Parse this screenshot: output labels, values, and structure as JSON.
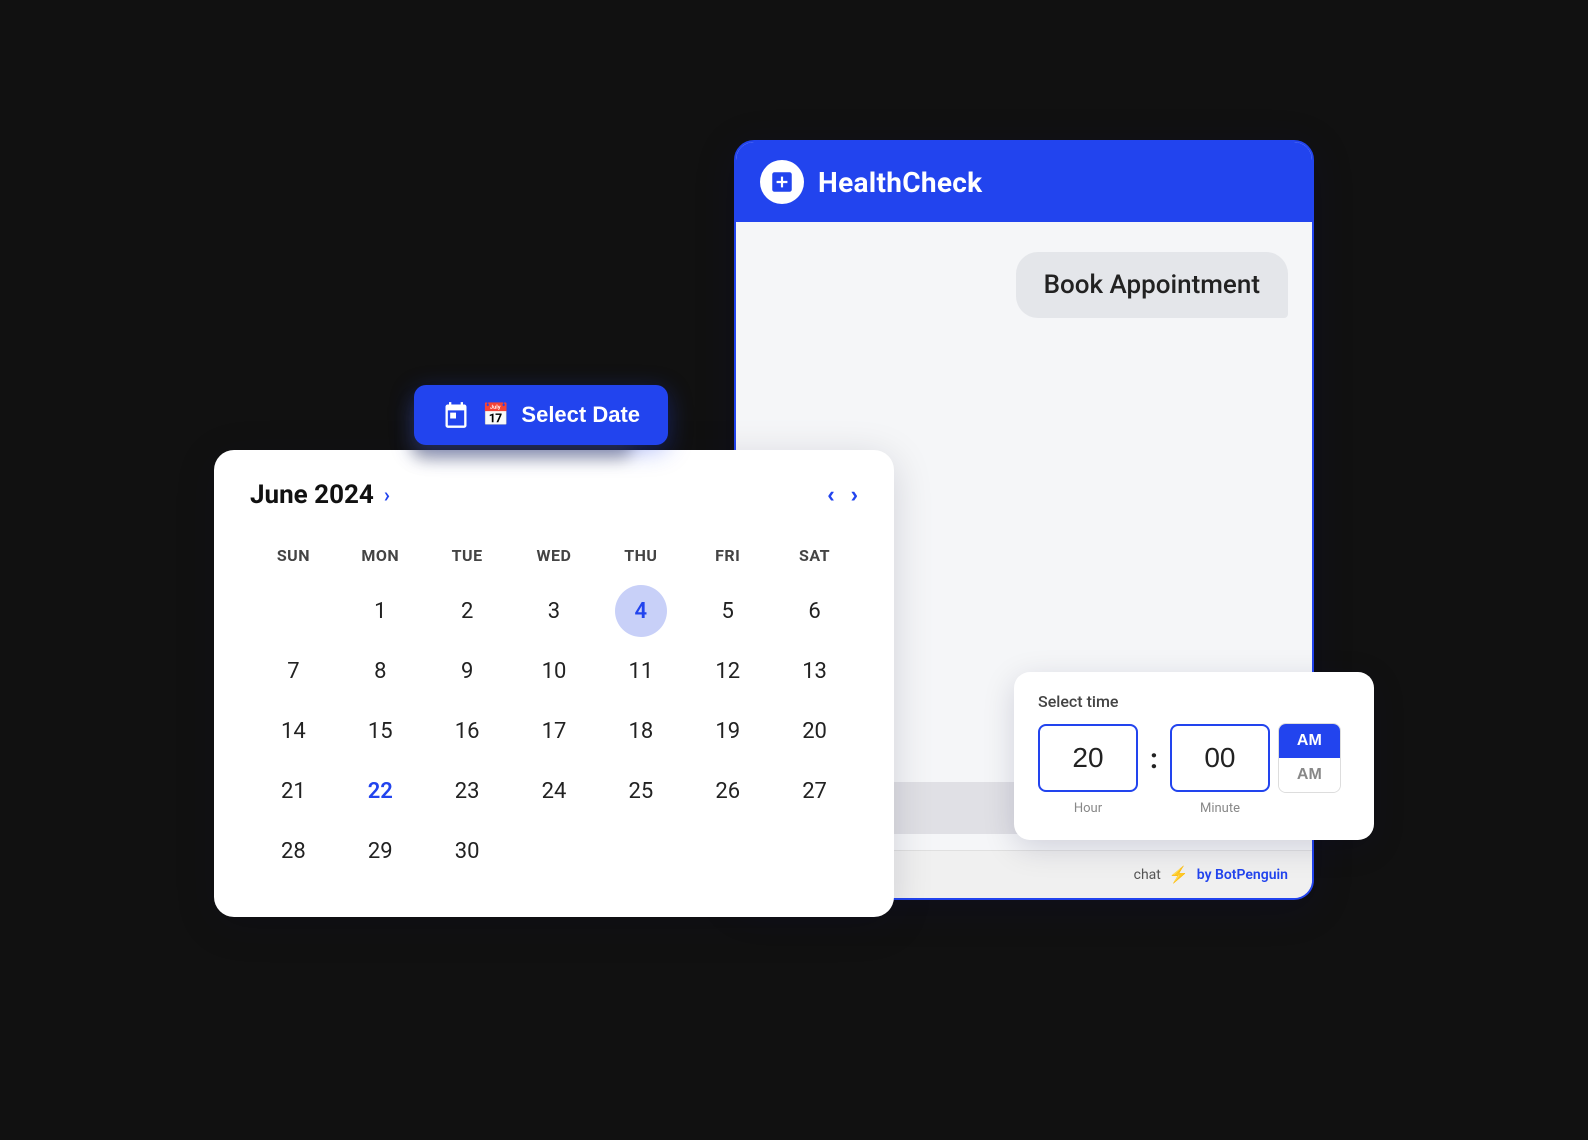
{
  "app": {
    "name": "HealthCheck",
    "header_bg": "#2244ee"
  },
  "chat": {
    "bot_bubble": "Book Appointment",
    "select_date_label": "Select Date",
    "footer_chat_label": "hat",
    "footer_lightning": "⚡",
    "footer_by": "by BotPenguin"
  },
  "calendar": {
    "month_label": "June 2024",
    "chevron_label": ">",
    "days_headers": [
      "SUN",
      "MON",
      "TUE",
      "WED",
      "THU",
      "FRI",
      "SAT"
    ],
    "selected_day": 4,
    "today_day": 22,
    "weeks": [
      [
        null,
        1,
        2,
        3,
        4,
        5,
        6
      ],
      [
        7,
        8,
        9,
        10,
        11,
        12,
        13
      ],
      [
        14,
        15,
        16,
        17,
        18,
        19,
        20
      ],
      [
        21,
        22,
        23,
        24,
        25,
        26,
        27
      ],
      [
        28,
        29,
        30,
        null,
        null,
        null,
        null
      ]
    ]
  },
  "time_picker": {
    "label": "Select time",
    "hour_value": "20",
    "minute_value": "00",
    "am_label": "AM",
    "pm_label": "AM",
    "hour_field_label": "Hour",
    "minute_field_label": "Minute"
  },
  "icons": {
    "plus_cross": "+"
  }
}
